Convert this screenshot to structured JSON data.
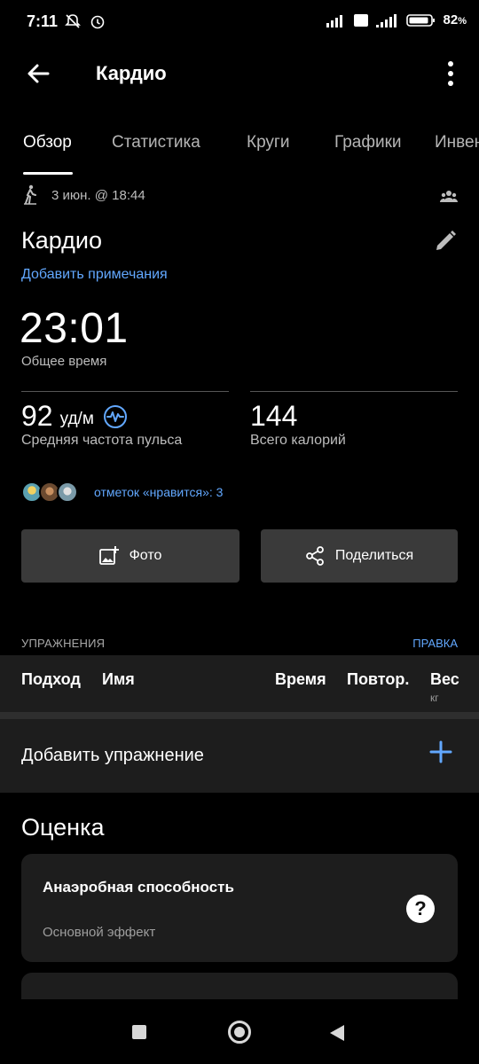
{
  "status": {
    "time": "7:11",
    "battery": "82"
  },
  "appbar": {
    "title": "Кардио"
  },
  "tabs": [
    "Обзор",
    "Статистика",
    "Круги",
    "Графики",
    "Инвентарь"
  ],
  "activity": {
    "date": "3 июн. @ 18:44",
    "name": "Кардио",
    "add_note": "Добавить примечания",
    "total_time": "23:01",
    "total_time_label": "Общее время",
    "avg_hr": "92",
    "avg_hr_unit": "уд/м",
    "avg_hr_label": "Средняя частота пульса",
    "calories": "144",
    "calories_label": "Всего калорий",
    "likes": "отметок «нравится»: 3"
  },
  "buttons": {
    "photo": "Фото",
    "share": "Поделиться"
  },
  "exercises": {
    "header": "УПРАЖНЕНИЯ",
    "edit": "ПРАВКА",
    "columns": [
      "Подход",
      "Имя",
      "Время",
      "Повтор.",
      "Вес"
    ],
    "weight_unit": "кг",
    "add_label": "Добавить упражнение"
  },
  "rating": {
    "title": "Оценка",
    "card_title": "Анаэробная способность",
    "card_subtitle": "Основной эффект",
    "help": "?"
  },
  "colors": {
    "accent": "#62a8ff",
    "background": "#000000",
    "surface": "#1d1d1d",
    "button": "#3a3a3a"
  }
}
